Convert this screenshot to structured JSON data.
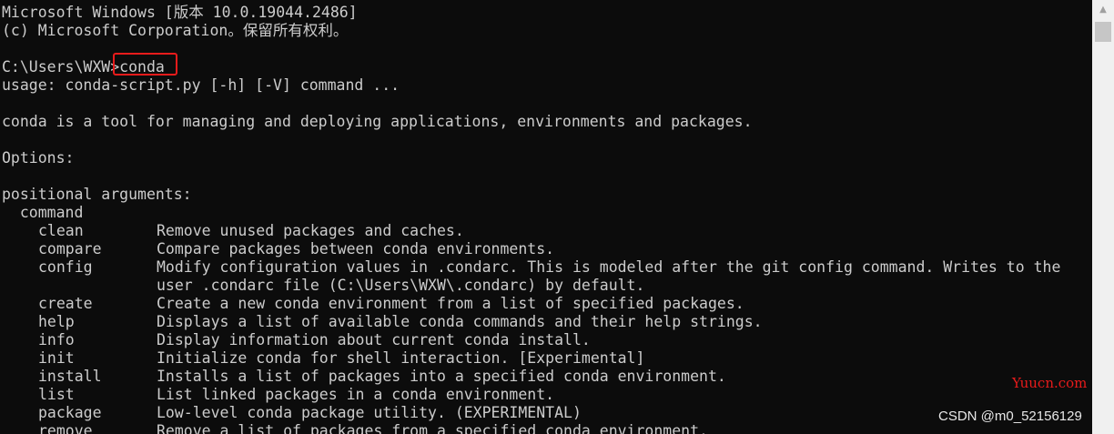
{
  "header": {
    "version_line": "Microsoft Windows [版本 10.0.19044.2486]",
    "copyright_line": "(c) Microsoft Corporation。保留所有权利。"
  },
  "prompt": {
    "path": "C:\\Users\\WXW>",
    "command": "conda",
    "highlight_color": "#e81b1b"
  },
  "output": {
    "usage": "usage: conda-script.py [-h] [-V] command ...",
    "description": "conda is a tool for managing and deploying applications, environments and packages.",
    "options_heading": "Options:",
    "positional_heading": "positional arguments:",
    "command_heading": "  command",
    "commands": [
      {
        "name": "clean",
        "desc": "Remove unused packages and caches."
      },
      {
        "name": "compare",
        "desc": "Compare packages between conda environments."
      },
      {
        "name": "config",
        "desc": "Modify configuration values in .condarc. This is modeled after the git config command. Writes to the"
      },
      {
        "name": "",
        "desc": "user .condarc file (C:\\Users\\WXW\\.condarc) by default."
      },
      {
        "name": "create",
        "desc": "Create a new conda environment from a list of specified packages."
      },
      {
        "name": "help",
        "desc": "Displays a list of available conda commands and their help strings."
      },
      {
        "name": "info",
        "desc": "Display information about current conda install."
      },
      {
        "name": "init",
        "desc": "Initialize conda for shell interaction. [Experimental]"
      },
      {
        "name": "install",
        "desc": "Installs a list of packages into a specified conda environment."
      },
      {
        "name": "list",
        "desc": "List linked packages in a conda environment."
      },
      {
        "name": "package",
        "desc": "Low-level conda package utility. (EXPERIMENTAL)"
      },
      {
        "name": "remove",
        "desc": "Remove a list of packages from a specified conda environment."
      }
    ]
  },
  "watermarks": {
    "yuucn": "Yuucn.com",
    "csdn": "CSDN @m0_52156129",
    "yuucn_color": "#e81b1b"
  },
  "scrollbar": {
    "up_icon": "triangle-up-icon"
  }
}
